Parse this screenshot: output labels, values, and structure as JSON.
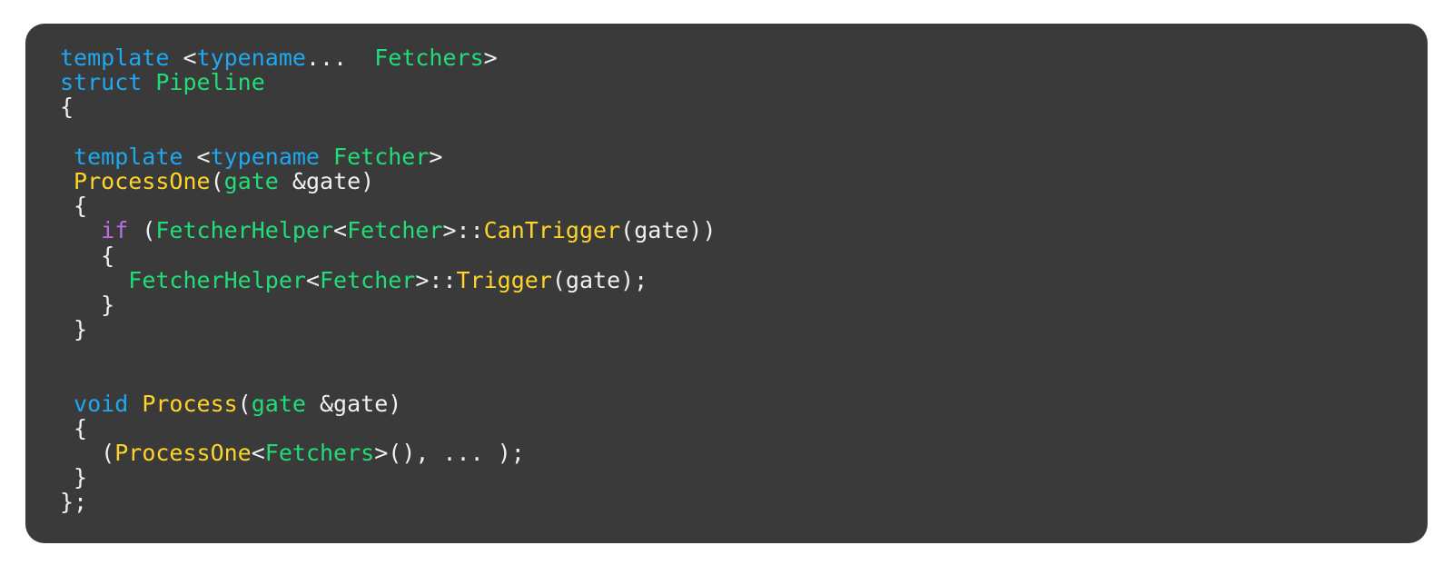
{
  "card": {
    "background": "#3a3a3a",
    "page_background": "#ffffff",
    "corner_radius_px": 21
  },
  "theme": {
    "keyword_color": "#1fa8f0",
    "type_color": "#22dd77",
    "function_color": "#ffd429",
    "control_keyword_color": "#bb70e0",
    "punctuation_color": "#f0f0f0"
  },
  "code": {
    "language": "C++",
    "lines": [
      {
        "id": "line-1",
        "tokens": [
          {
            "text": "template ",
            "kind": "kw"
          },
          {
            "text": "<",
            "kind": "pun"
          },
          {
            "text": "typename",
            "kind": "kw"
          },
          {
            "text": "... ",
            "kind": "pun"
          },
          {
            "text": " Fetchers",
            "kind": "typ"
          },
          {
            "text": ">",
            "kind": "pun"
          }
        ]
      },
      {
        "id": "line-2",
        "tokens": [
          {
            "text": "struct ",
            "kind": "kw"
          },
          {
            "text": "Pipeline",
            "kind": "typ"
          }
        ]
      },
      {
        "id": "line-3",
        "tokens": [
          {
            "text": "{",
            "kind": "pun"
          }
        ]
      },
      {
        "id": "line-4",
        "tokens": []
      },
      {
        "id": "line-5",
        "tokens": [
          {
            "text": " template ",
            "kind": "kw"
          },
          {
            "text": "<",
            "kind": "pun"
          },
          {
            "text": "typename ",
            "kind": "kw"
          },
          {
            "text": "Fetcher",
            "kind": "typ"
          },
          {
            "text": ">",
            "kind": "pun"
          }
        ]
      },
      {
        "id": "line-6",
        "tokens": [
          {
            "text": " ProcessOne",
            "kind": "fn"
          },
          {
            "text": "(",
            "kind": "pun"
          },
          {
            "text": "gate",
            "kind": "typ"
          },
          {
            "text": " &gate)",
            "kind": "pun"
          }
        ]
      },
      {
        "id": "line-7",
        "tokens": [
          {
            "text": " {",
            "kind": "pun"
          }
        ]
      },
      {
        "id": "line-8",
        "tokens": [
          {
            "text": "   ",
            "kind": "pun"
          },
          {
            "text": "if",
            "kind": "ctl"
          },
          {
            "text": " (",
            "kind": "pun"
          },
          {
            "text": "FetcherHelper",
            "kind": "typ"
          },
          {
            "text": "<",
            "kind": "pun"
          },
          {
            "text": "Fetcher",
            "kind": "typ"
          },
          {
            "text": ">::",
            "kind": "pun"
          },
          {
            "text": "CanTrigger",
            "kind": "fn"
          },
          {
            "text": "(gate))",
            "kind": "pun"
          }
        ]
      },
      {
        "id": "line-9",
        "tokens": [
          {
            "text": "   {",
            "kind": "pun"
          }
        ]
      },
      {
        "id": "line-10",
        "tokens": [
          {
            "text": "     ",
            "kind": "pun"
          },
          {
            "text": "FetcherHelper",
            "kind": "typ"
          },
          {
            "text": "<",
            "kind": "pun"
          },
          {
            "text": "Fetcher",
            "kind": "typ"
          },
          {
            "text": ">::",
            "kind": "pun"
          },
          {
            "text": "Trigger",
            "kind": "fn"
          },
          {
            "text": "(gate);",
            "kind": "pun"
          }
        ]
      },
      {
        "id": "line-11",
        "tokens": [
          {
            "text": "   }",
            "kind": "pun"
          }
        ]
      },
      {
        "id": "line-12",
        "tokens": [
          {
            "text": " }",
            "kind": "pun"
          }
        ]
      },
      {
        "id": "line-13",
        "tokens": []
      },
      {
        "id": "line-14",
        "tokens": []
      },
      {
        "id": "line-15",
        "tokens": [
          {
            "text": " void ",
            "kind": "kw"
          },
          {
            "text": "Process",
            "kind": "fn"
          },
          {
            "text": "(",
            "kind": "pun"
          },
          {
            "text": "gate",
            "kind": "typ"
          },
          {
            "text": " &gate)",
            "kind": "pun"
          }
        ]
      },
      {
        "id": "line-16",
        "tokens": [
          {
            "text": " {",
            "kind": "pun"
          }
        ]
      },
      {
        "id": "line-17",
        "tokens": [
          {
            "text": "   (",
            "kind": "pun"
          },
          {
            "text": "ProcessOne",
            "kind": "fn"
          },
          {
            "text": "<",
            "kind": "pun"
          },
          {
            "text": "Fetchers",
            "kind": "typ"
          },
          {
            "text": ">(), ",
            "kind": "pun"
          },
          {
            "text": "... );",
            "kind": "pun"
          }
        ]
      },
      {
        "id": "line-18",
        "tokens": [
          {
            "text": " }",
            "kind": "pun"
          }
        ]
      },
      {
        "id": "line-19",
        "tokens": [
          {
            "text": "};",
            "kind": "pun"
          }
        ]
      }
    ]
  }
}
